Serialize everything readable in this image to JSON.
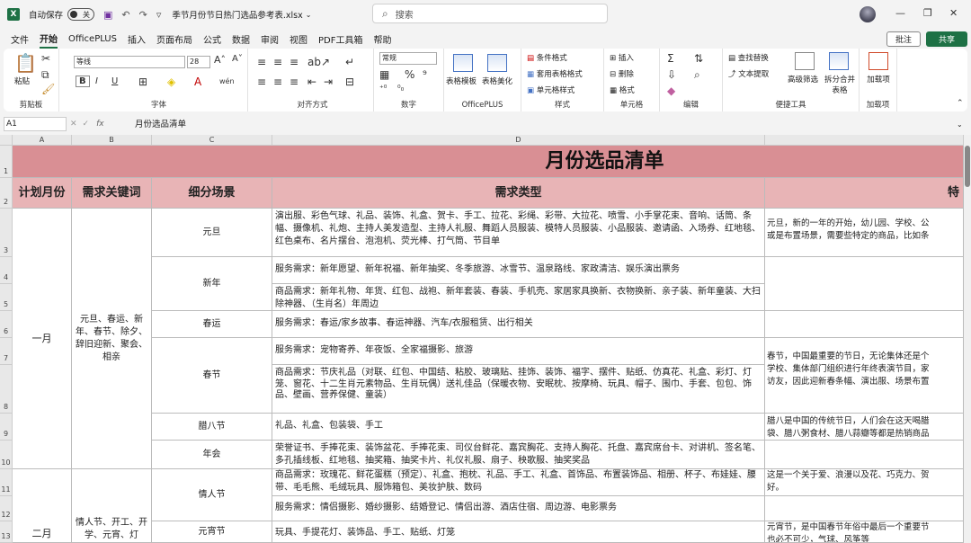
{
  "titlebar": {
    "app_logo": "X",
    "autosave_label": "自动保存",
    "autosave_state": "关",
    "filename": "季节月份节日热门选品参考表.xlsx",
    "search_placeholder": "搜索"
  },
  "menu": {
    "items": [
      "文件",
      "开始",
      "OfficePLUS",
      "插入",
      "页面布局",
      "公式",
      "数据",
      "审阅",
      "视图",
      "PDF工具箱",
      "帮助"
    ],
    "active": "开始",
    "notes": "批注",
    "share": "共享"
  },
  "ribbon": {
    "clipboard": {
      "paste": "粘贴",
      "label": "剪贴板"
    },
    "font": {
      "name": "等线",
      "size": "28",
      "bold": "B",
      "italic": "I",
      "underline": "U",
      "label": "字体"
    },
    "align": {
      "label": "对齐方式"
    },
    "number": {
      "format": "常规",
      "label": "数字"
    },
    "officeplus": {
      "table_template": "表格模板",
      "table_beautify": "表格美化",
      "label": "OfficePLUS"
    },
    "styles": {
      "cond": "条件格式",
      "table_fmt": "套用表格格式",
      "cell_style": "单元格样式",
      "label": "样式"
    },
    "cells": {
      "insert": "插入",
      "delete": "删除",
      "format": "格式",
      "label": "单元格"
    },
    "editing": {
      "label": "编辑"
    },
    "tools": {
      "find_replace": "查找替换",
      "text_extract": "文本提取",
      "adv_filter": "高级筛选",
      "split_merge": "拆分合并表格",
      "label": "便捷工具"
    },
    "addins": {
      "load": "加载项",
      "label": "加载项"
    }
  },
  "formula": {
    "cell_ref": "A1",
    "fx": "fx",
    "content": "月份选品清单"
  },
  "sheet": {
    "columns": [
      "A",
      "B",
      "C",
      "D"
    ],
    "rows": [
      "1",
      "2",
      "3",
      "4",
      "5",
      "6",
      "7",
      "8",
      "9",
      "10",
      "11",
      "12",
      "13"
    ],
    "title": "月份选品清单",
    "headers": {
      "a": "计划月份",
      "b": "需求关键词",
      "c": "细分场景",
      "d": "需求类型",
      "e": "特"
    },
    "month1": "一月",
    "keywords1": "元旦、春运、新年、春节、除夕、辞旧迎新、聚会、相亲",
    "month2": "二月",
    "keywords2": "情人节、开工、开学、元宵、灯",
    "scenes": {
      "yuandan": "元旦",
      "xinnian": "新年",
      "chunyun": "春运",
      "chunjie": "春节",
      "laba": "腊八节",
      "nianhui": "年会",
      "qingren": "情人节",
      "yuanxiao": "元宵节"
    },
    "d3": "演出服、彩色气球、礼品、装饰、礼盒、贺卡、手工、拉花、彩绳、彩带、大拉花、喷雪、小手掌花束、音响、话筒、条幅、摄像机、礼炮、主持人美发造型、主持人礼服、舞蹈人员服装、模特人员服装、小品服装、邀请函、入场券、红地毯、红色桌布、名片摆台、泡泡机、荧光棒、打气筒、节目单",
    "d4": "服务需求：新年愿望、新年祝福、新年抽奖、冬季旅游、冰雪节、温泉路线、家政清洁、娱乐演出票务",
    "d5": "商品需求：新年礼物、年货、红包、战袍、新年套装、春装、手机壳、家居家具换新、衣物换新、亲子装、新年童装、大扫除神器、（生肖名）年周边",
    "d6": "服务需求：春运/家乡故事、春运神器、汽车/衣服租赁、出行相关",
    "d7": "服务需求：宠物寄养、年夜饭、全家福摄影、旅游",
    "d8": "商品需求：节庆礼品（对联、红包、中国结、粘胶、玻璃贴、挂饰、装饰、福字、摆件、贴纸、仿真花、礼盒、彩灯、灯笼、窗花、十二生肖元素物品、生肖玩偶）送礼佳品（保暖衣物、安眠枕、按摩椅、玩具、帽子、围巾、手套、包包、饰品、壁画、营养保健、童装）",
    "d9": "礼品、礼盒、包装袋、手工",
    "d10": "荣誉证书、手捧花束、装饰盆花、手捧花束、司仪台鲜花、嘉宾胸花、支持人胸花、托盘、嘉宾席台卡、对讲机、签名笔、多孔插线板、红地毯、抽奖箱、抽奖卡片、礼仪礼服、扇子、秧歌服、抽奖奖品",
    "d11": "商品需求：玫瑰花、鲜花蛋糕（预定）、礼盒、抱枕、礼品、手工、礼盒、首饰品、布置装饰品、相册、杯子、布娃娃、腰带、毛毛熊、毛绒玩具、服饰箱包、美妆护肤、数码",
    "d12": "服务需求：情侣摄影、婚纱摄影、结婚登记、情侣出游、酒店住宿、周边游、电影票务",
    "d13": "玩具、手提花灯、装饰品、手工、贴纸、灯笼",
    "e3": [
      "元旦，新的一年的开始，幼儿园、学校、公",
      "或是布置场景，需要些特定的商品，比如条"
    ],
    "e7": [
      "春节，中国最重要的节日，无论集体还是个",
      "学校、集体部门组织进行年终表演节目，家",
      "访友，因此迎新春条幅、演出服、场景布置"
    ],
    "e9": [
      "腊八是中国的传统节日，人们会在这天喝腊",
      "袋、腊八粥食材、腊八蒜瓣等都是热销商品"
    ],
    "e11": [
      "这是一个关于爱、浪漫以及花、巧克力、贺",
      "好。"
    ],
    "e13": [
      "元宵节，是中国春节年俗中最后一个重要节",
      "也必不可少，气球、风筝等"
    ]
  }
}
